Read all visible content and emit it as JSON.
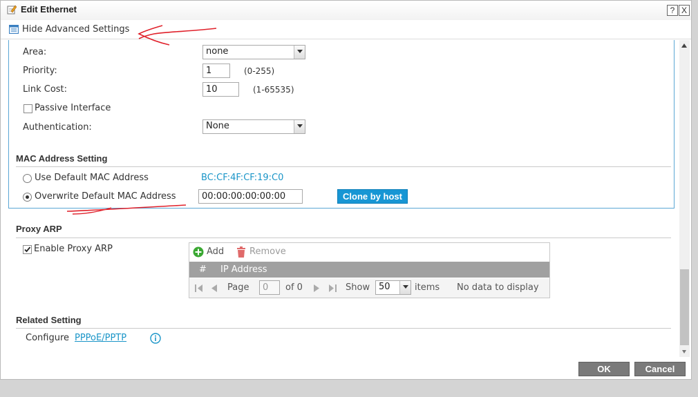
{
  "window": {
    "title": "Edit Ethernet",
    "help_label": "?",
    "close_label": "X"
  },
  "advanced": {
    "toggle_label": "Hide Advanced Settings"
  },
  "ospf": {
    "area_label": "Area:",
    "area_value": "none",
    "priority_label": "Priority:",
    "priority_value": "1",
    "priority_hint": "(0-255)",
    "link_cost_label": "Link Cost:",
    "link_cost_value": "10",
    "link_cost_hint": "(1-65535)",
    "passive_label": "Passive Interface",
    "passive_checked": false,
    "auth_label": "Authentication:",
    "auth_value": "None"
  },
  "mac": {
    "section_title": "MAC Address Setting",
    "use_default_label": "Use Default MAC Address",
    "default_mac": "BC:CF:4F:CF:19:C0",
    "overwrite_label": "Overwrite Default MAC Address",
    "overwrite_value": "00:00:00:00:00:00",
    "selected": "overwrite",
    "clone_button": "Clone by host"
  },
  "proxy_arp": {
    "section_title": "Proxy ARP",
    "enable_label": "Enable Proxy ARP",
    "enable_checked": true,
    "add_label": "Add",
    "remove_label": "Remove",
    "columns": [
      "#",
      "IP Address"
    ],
    "pager": {
      "page_label": "Page",
      "page_value": "0",
      "of_label": "of 0",
      "show_label": "Show",
      "show_value": "50",
      "items_label": "items",
      "empty_text": "No data to display"
    }
  },
  "related": {
    "section_title": "Related Setting",
    "configure_label": "Configure",
    "link_label": "PPPoE/PPTP"
  },
  "footer": {
    "ok_label": "OK",
    "cancel_label": "Cancel"
  },
  "colors": {
    "accent": "#1796d4",
    "link": "#1a95c8",
    "annotation": "#e0202a",
    "add_green": "#3aa832",
    "remove_red": "#e06a6a"
  },
  "icons": [
    "edit-icon",
    "settings-list-icon",
    "chevron-down-icon",
    "add-icon",
    "trash-icon",
    "first-page-icon",
    "prev-page-icon",
    "next-page-icon",
    "last-page-icon",
    "info-icon"
  ]
}
